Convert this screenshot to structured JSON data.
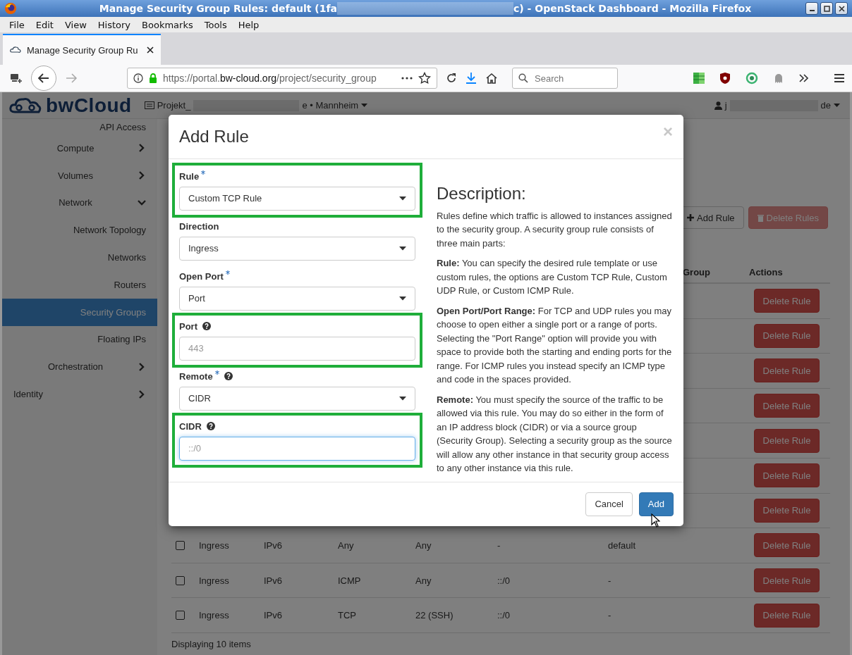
{
  "window": {
    "title_start": "Manage Security Group Rules: default (1fa",
    "title_end": "c) - OpenStack Dashboard - Mozilla Firefox"
  },
  "menu": [
    "File",
    "Edit",
    "View",
    "History",
    "Bookmarks",
    "Tools",
    "Help"
  ],
  "tabs": [
    {
      "label": "Manage Security Group Ru",
      "selected": true
    }
  ],
  "address_bar": {
    "scheme": "https://portal.",
    "domain": "bw-cloud.org",
    "path": "/project/security_group"
  },
  "search": {
    "placeholder": "Search"
  },
  "header": {
    "brand": "bwCloud",
    "project_start": "Projekt_",
    "project_end": "e • Mannheim",
    "user_start": "j",
    "user_end": "de"
  },
  "sidebar": {
    "items": [
      {
        "kind": "panel",
        "label": "API Access",
        "selected": false
      },
      {
        "kind": "group",
        "label": "Compute",
        "expanded": false
      },
      {
        "kind": "group",
        "label": "Volumes",
        "expanded": false
      },
      {
        "kind": "group",
        "label": "Network",
        "expanded": true,
        "children": [
          {
            "kind": "panel",
            "label": "Network Topology",
            "selected": false
          },
          {
            "kind": "panel",
            "label": "Networks",
            "selected": false
          },
          {
            "kind": "panel",
            "label": "Routers",
            "selected": false
          },
          {
            "kind": "panel",
            "label": "Security Groups",
            "selected": true
          },
          {
            "kind": "panel",
            "label": "Floating IPs",
            "selected": false
          }
        ]
      },
      {
        "kind": "group",
        "label": "Orchestration",
        "expanded": false
      },
      {
        "kind": "dashboard",
        "label": "Identity",
        "expanded": false
      }
    ]
  },
  "toolbar": [
    {
      "kind": "add",
      "label": "Add Rule",
      "disabled": false
    },
    {
      "kind": "delete",
      "label": "Delete Rules",
      "disabled": true
    }
  ],
  "table": {
    "columns": [
      {
        "label": "Group"
      },
      {
        "label": "Actions"
      }
    ],
    "rows": [
      {
        "action": "Delete Rule"
      },
      {
        "action": "Delete Rule"
      },
      {
        "action": "Delete Rule"
      },
      {
        "action": "Delete Rule"
      },
      {
        "action": "Delete Rule"
      },
      {
        "action": "Delete Rule"
      },
      {
        "action": "Delete Rule"
      },
      {
        "checked": false,
        "cells": [
          "Ingress",
          "IPv6",
          "Any",
          "Any",
          "-",
          "default"
        ],
        "action": "Delete Rule"
      },
      {
        "checked": false,
        "cells": [
          "Ingress",
          "IPv6",
          "ICMP",
          "Any",
          "::/0",
          "-"
        ],
        "action": "Delete Rule"
      },
      {
        "checked": false,
        "cells": [
          "Ingress",
          "IPv6",
          "TCP",
          "22 (SSH)",
          "::/0",
          "-"
        ],
        "action": "Delete Rule"
      }
    ],
    "footer": "Displaying 10 items"
  },
  "modal": {
    "title": "Add Rule",
    "close": "×",
    "fields": [
      {
        "kind": "select",
        "label": "Rule",
        "required": true,
        "help": false,
        "value": "Custom TCP Rule",
        "highlighted": true
      },
      {
        "kind": "select",
        "label": "Direction",
        "required": false,
        "help": false,
        "value": "Ingress",
        "highlighted": false
      },
      {
        "kind": "select",
        "label": "Open Port",
        "required": true,
        "help": false,
        "value": "Port",
        "highlighted": false
      },
      {
        "kind": "input",
        "label": "Port",
        "required": false,
        "help": true,
        "placeholder": "443",
        "focused": false,
        "highlighted": true
      },
      {
        "kind": "select",
        "label": "Remote",
        "required": true,
        "help": true,
        "value": "CIDR",
        "highlighted": false
      },
      {
        "kind": "input",
        "label": "CIDR",
        "required": false,
        "help": true,
        "placeholder": "::/0",
        "focused": true,
        "highlighted": true
      }
    ],
    "description": {
      "heading": "Description:",
      "paragraphs": [
        "Rules define which traffic is allowed to instances assigned to the security group. A security group rule consists of three main parts:",
        "**Rule:** You can specify the desired rule template or use custom rules, the options are Custom TCP Rule, Custom UDP Rule, or Custom ICMP Rule.",
        "**Open Port/Port Range:** For TCP and UDP rules you may choose to open either a single port or a range of ports. Selecting the \"Port Range\" option will provide you with space to provide both the starting and ending ports for the range. For ICMP rules you instead specify an ICMP type and code in the spaces provided.",
        "**Remote:** You must specify the source of the traffic to be allowed via this rule. You may do so either in the form of an IP address block (CIDR) or via a source group (Security Group). Selecting a security group as the source will allow any other instance in that security group access to any other instance via this rule."
      ]
    },
    "buttons": [
      {
        "kind": "secondary",
        "label": "Cancel"
      },
      {
        "kind": "primary",
        "label": "Add"
      }
    ]
  }
}
